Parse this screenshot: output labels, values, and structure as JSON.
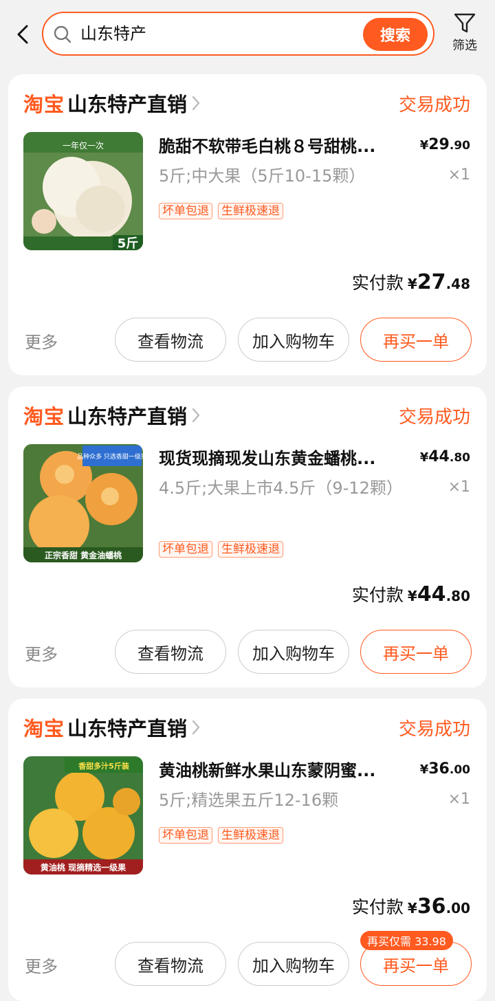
{
  "search": {
    "query": "山东特产",
    "button_label": "搜索",
    "filter_label": "筛选"
  },
  "common": {
    "taobao_label": "淘宝",
    "more_label": "更多",
    "logistics_label": "查看物流",
    "add_cart_label": "加入购物车",
    "rebuy_label": "再买一单",
    "paid_label": "实付款",
    "currency": "¥"
  },
  "orders": [
    {
      "shop": "山东特产直销",
      "status": "交易成功",
      "title": "脆甜不软带毛白桃８号甜桃...",
      "price_int": "29",
      "price_dec": ".90",
      "spec": "5斤;中大果（5斤10-15颗）",
      "qty": "×1",
      "tags": [
        "坏单包退",
        "生鲜极速退"
      ],
      "paid_int": "27",
      "paid_dec": ".48",
      "image_text_top": "一年仅一次",
      "image_text_bottom": "5斤"
    },
    {
      "shop": "山东特产直销",
      "status": "交易成功",
      "title": "现货现摘现发山东黄金蟠桃...",
      "price_int": "44",
      "price_dec": ".80",
      "spec": "4.5斤;大果上市4.5斤（9-12颗）",
      "qty": "×1",
      "tags": [
        "坏单包退",
        "生鲜极速退"
      ],
      "paid_int": "44",
      "paid_dec": ".80",
      "image_text_top": "品种众多 只选香甜一级果",
      "image_text_bottom": "正宗香甜   黄金油蟠桃"
    },
    {
      "shop": "山东特产直销",
      "status": "交易成功",
      "title": "黄油桃新鲜水果山东蒙阴蜜...",
      "price_int": "36",
      "price_dec": ".00",
      "spec": "5斤;精选果五斤12-16颗",
      "qty": "×1",
      "tags": [
        "坏单包退",
        "生鲜极速退"
      ],
      "paid_int": "36",
      "paid_dec": ".00",
      "image_text_top": "香甜多汁5斤装",
      "image_text_bottom": "黄油桃   现摘精选一级果",
      "rebuy_badge": "再买仅需 33.98"
    }
  ],
  "colors": {
    "accent": "#ff5a1f",
    "background": "#f2f2f2",
    "muted": "#999999"
  }
}
